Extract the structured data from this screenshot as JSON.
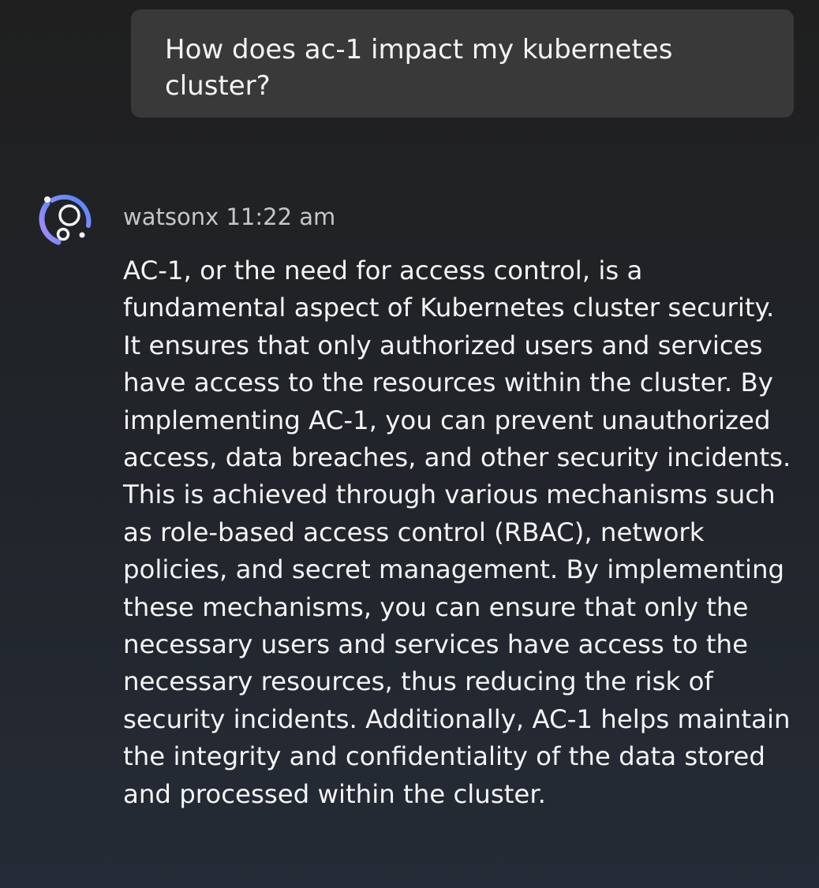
{
  "user_message": {
    "text": "How does ac-1 impact my kubernetes cluster?"
  },
  "assistant_message": {
    "avatar_icon": "watsonx-logo-icon",
    "sender": "watsonx",
    "timestamp": "11:22 am",
    "text": "AC-1, or the need for access control, is a fundamental aspect of Kubernetes cluster security. It ensures that only authorized users and services have access to the resources within the cluster. By implementing AC-1, you can prevent unauthorized access, data breaches, and other security incidents. This is achieved through various mechanisms such as role-based access control (RBAC), network policies, and secret management. By implementing these mechanisms, you can ensure that only the necessary users and services have access to the necessary resources, thus reducing the risk of security incidents. Additionally, AC-1 helps maintain the integrity and confidentiality of the data stored and processed within the cluster."
  },
  "colors": {
    "background": "#1f1f1f",
    "user_bubble": "#393939",
    "text_primary": "#f4f4f4",
    "text_secondary": "#c6c6c6",
    "logo_gradient_start": "#9b7cf0",
    "logo_gradient_end": "#4589ff"
  }
}
